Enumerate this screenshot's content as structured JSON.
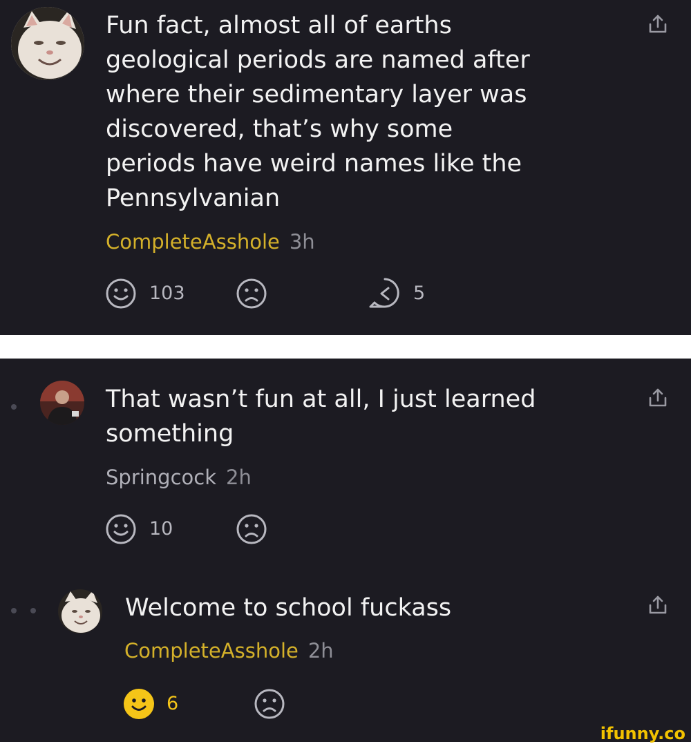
{
  "comments": [
    {
      "text": "Fun fact, almost all of earths\ngeological periods are named after\nwhere their sedimentary layer was\ndiscovered, that’s why some\nperiods have weird names like the\nPennsylvanian",
      "username": "CompleteAsshole",
      "time": "3h",
      "smile_count": "103",
      "reply_count": "5",
      "username_color": "#d4b12a"
    },
    {
      "text": "That wasn’t fun at all, I just learned\nsomething",
      "username": "Springcock",
      "time": "2h",
      "smile_count": "10",
      "username_color": "#b0b0b8"
    },
    {
      "text": "Welcome to school fuckass",
      "username": "CompleteAsshole",
      "time": "2h",
      "smile_count": "6",
      "smiled": true,
      "username_color": "#d4b12a"
    }
  ],
  "icons": {
    "smile": "smile-icon",
    "frown": "frown-icon",
    "reply": "reply-icon",
    "share": "share-icon"
  },
  "colors": {
    "background": "#1c1b22",
    "accent_yellow": "#f5c518",
    "muted": "#8e8e96"
  },
  "watermark": "ifunny.co"
}
